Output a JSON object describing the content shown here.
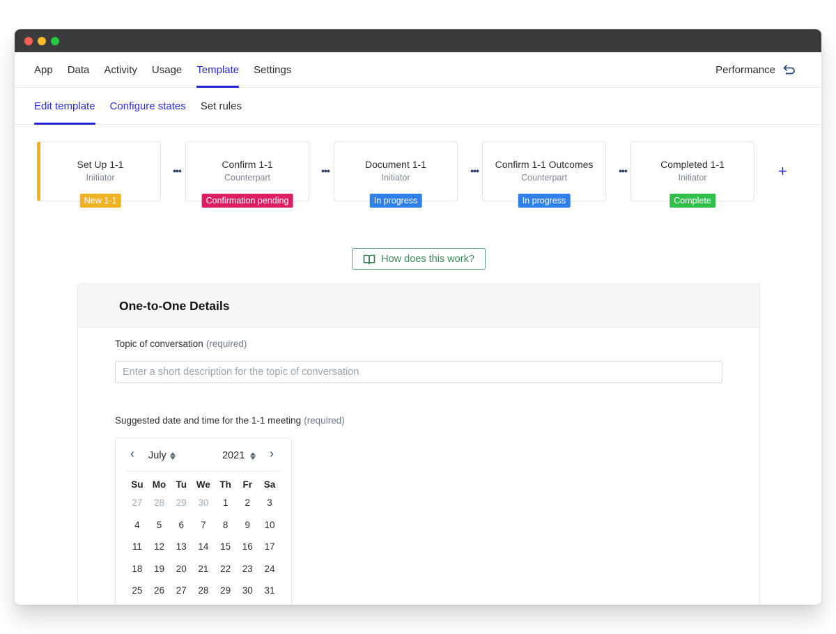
{
  "window": {
    "controls": [
      "close",
      "minimize",
      "maximize"
    ]
  },
  "topnav": {
    "items": [
      {
        "label": "App",
        "active": false
      },
      {
        "label": "Data",
        "active": false
      },
      {
        "label": "Activity",
        "active": false
      },
      {
        "label": "Usage",
        "active": false
      },
      {
        "label": "Template",
        "active": true
      },
      {
        "label": "Settings",
        "active": false
      }
    ],
    "right_label": "Performance",
    "right_icon": "back-arrow-icon"
  },
  "subnav": {
    "items": [
      {
        "label": "Edit template",
        "active": true
      },
      {
        "label": "Configure states",
        "active": false
      },
      {
        "label": "Set rules",
        "active": false
      }
    ]
  },
  "states": [
    {
      "title": "Set Up 1-1",
      "role": "Initiator",
      "badge": "New 1-1",
      "badge_color": "#f0b323"
    },
    {
      "title": "Confirm 1-1",
      "role": "Counterpart",
      "badge": "Confirmation pending",
      "badge_color": "#dc1f64"
    },
    {
      "title": "Document 1-1",
      "role": "Initiator",
      "badge": "In progress",
      "badge_color": "#2f80e8"
    },
    {
      "title": "Confirm 1-1 Outcomes",
      "role": "Counterpart",
      "badge": "In progress",
      "badge_color": "#2f80e8"
    },
    {
      "title": "Completed 1-1",
      "role": "Initiator",
      "badge": "Complete",
      "badge_color": "#2fbf4a"
    }
  ],
  "state_separator": "•••",
  "add_state_label": "+",
  "help_button": {
    "label": "How does this work?",
    "icon": "book-icon"
  },
  "details": {
    "title": "One-to-One Details",
    "topic": {
      "label": "Topic of conversation",
      "required": "(required)",
      "placeholder": "Enter a short description for the topic of conversation",
      "value": ""
    },
    "date": {
      "label": "Suggested date and time for the 1-1 meeting",
      "required": "(required)"
    }
  },
  "calendar": {
    "month": "July",
    "year": "2021",
    "prev_label": "‹",
    "next_label": "›",
    "weekdays": [
      "Su",
      "Mo",
      "Tu",
      "We",
      "Th",
      "Fr",
      "Sa"
    ],
    "weeks": [
      [
        {
          "d": "27",
          "muted": true
        },
        {
          "d": "28",
          "muted": true
        },
        {
          "d": "29",
          "muted": true
        },
        {
          "d": "30",
          "muted": true
        },
        {
          "d": "1"
        },
        {
          "d": "2"
        },
        {
          "d": "3"
        }
      ],
      [
        {
          "d": "4"
        },
        {
          "d": "5"
        },
        {
          "d": "6"
        },
        {
          "d": "7"
        },
        {
          "d": "8"
        },
        {
          "d": "9"
        },
        {
          "d": "10"
        }
      ],
      [
        {
          "d": "11"
        },
        {
          "d": "12"
        },
        {
          "d": "13"
        },
        {
          "d": "14"
        },
        {
          "d": "15"
        },
        {
          "d": "16"
        },
        {
          "d": "17"
        }
      ],
      [
        {
          "d": "18"
        },
        {
          "d": "19"
        },
        {
          "d": "20"
        },
        {
          "d": "21"
        },
        {
          "d": "22"
        },
        {
          "d": "23"
        },
        {
          "d": "24"
        }
      ],
      [
        {
          "d": "25"
        },
        {
          "d": "26"
        },
        {
          "d": "27"
        },
        {
          "d": "28"
        },
        {
          "d": "29"
        },
        {
          "d": "30"
        },
        {
          "d": "31"
        }
      ]
    ]
  }
}
